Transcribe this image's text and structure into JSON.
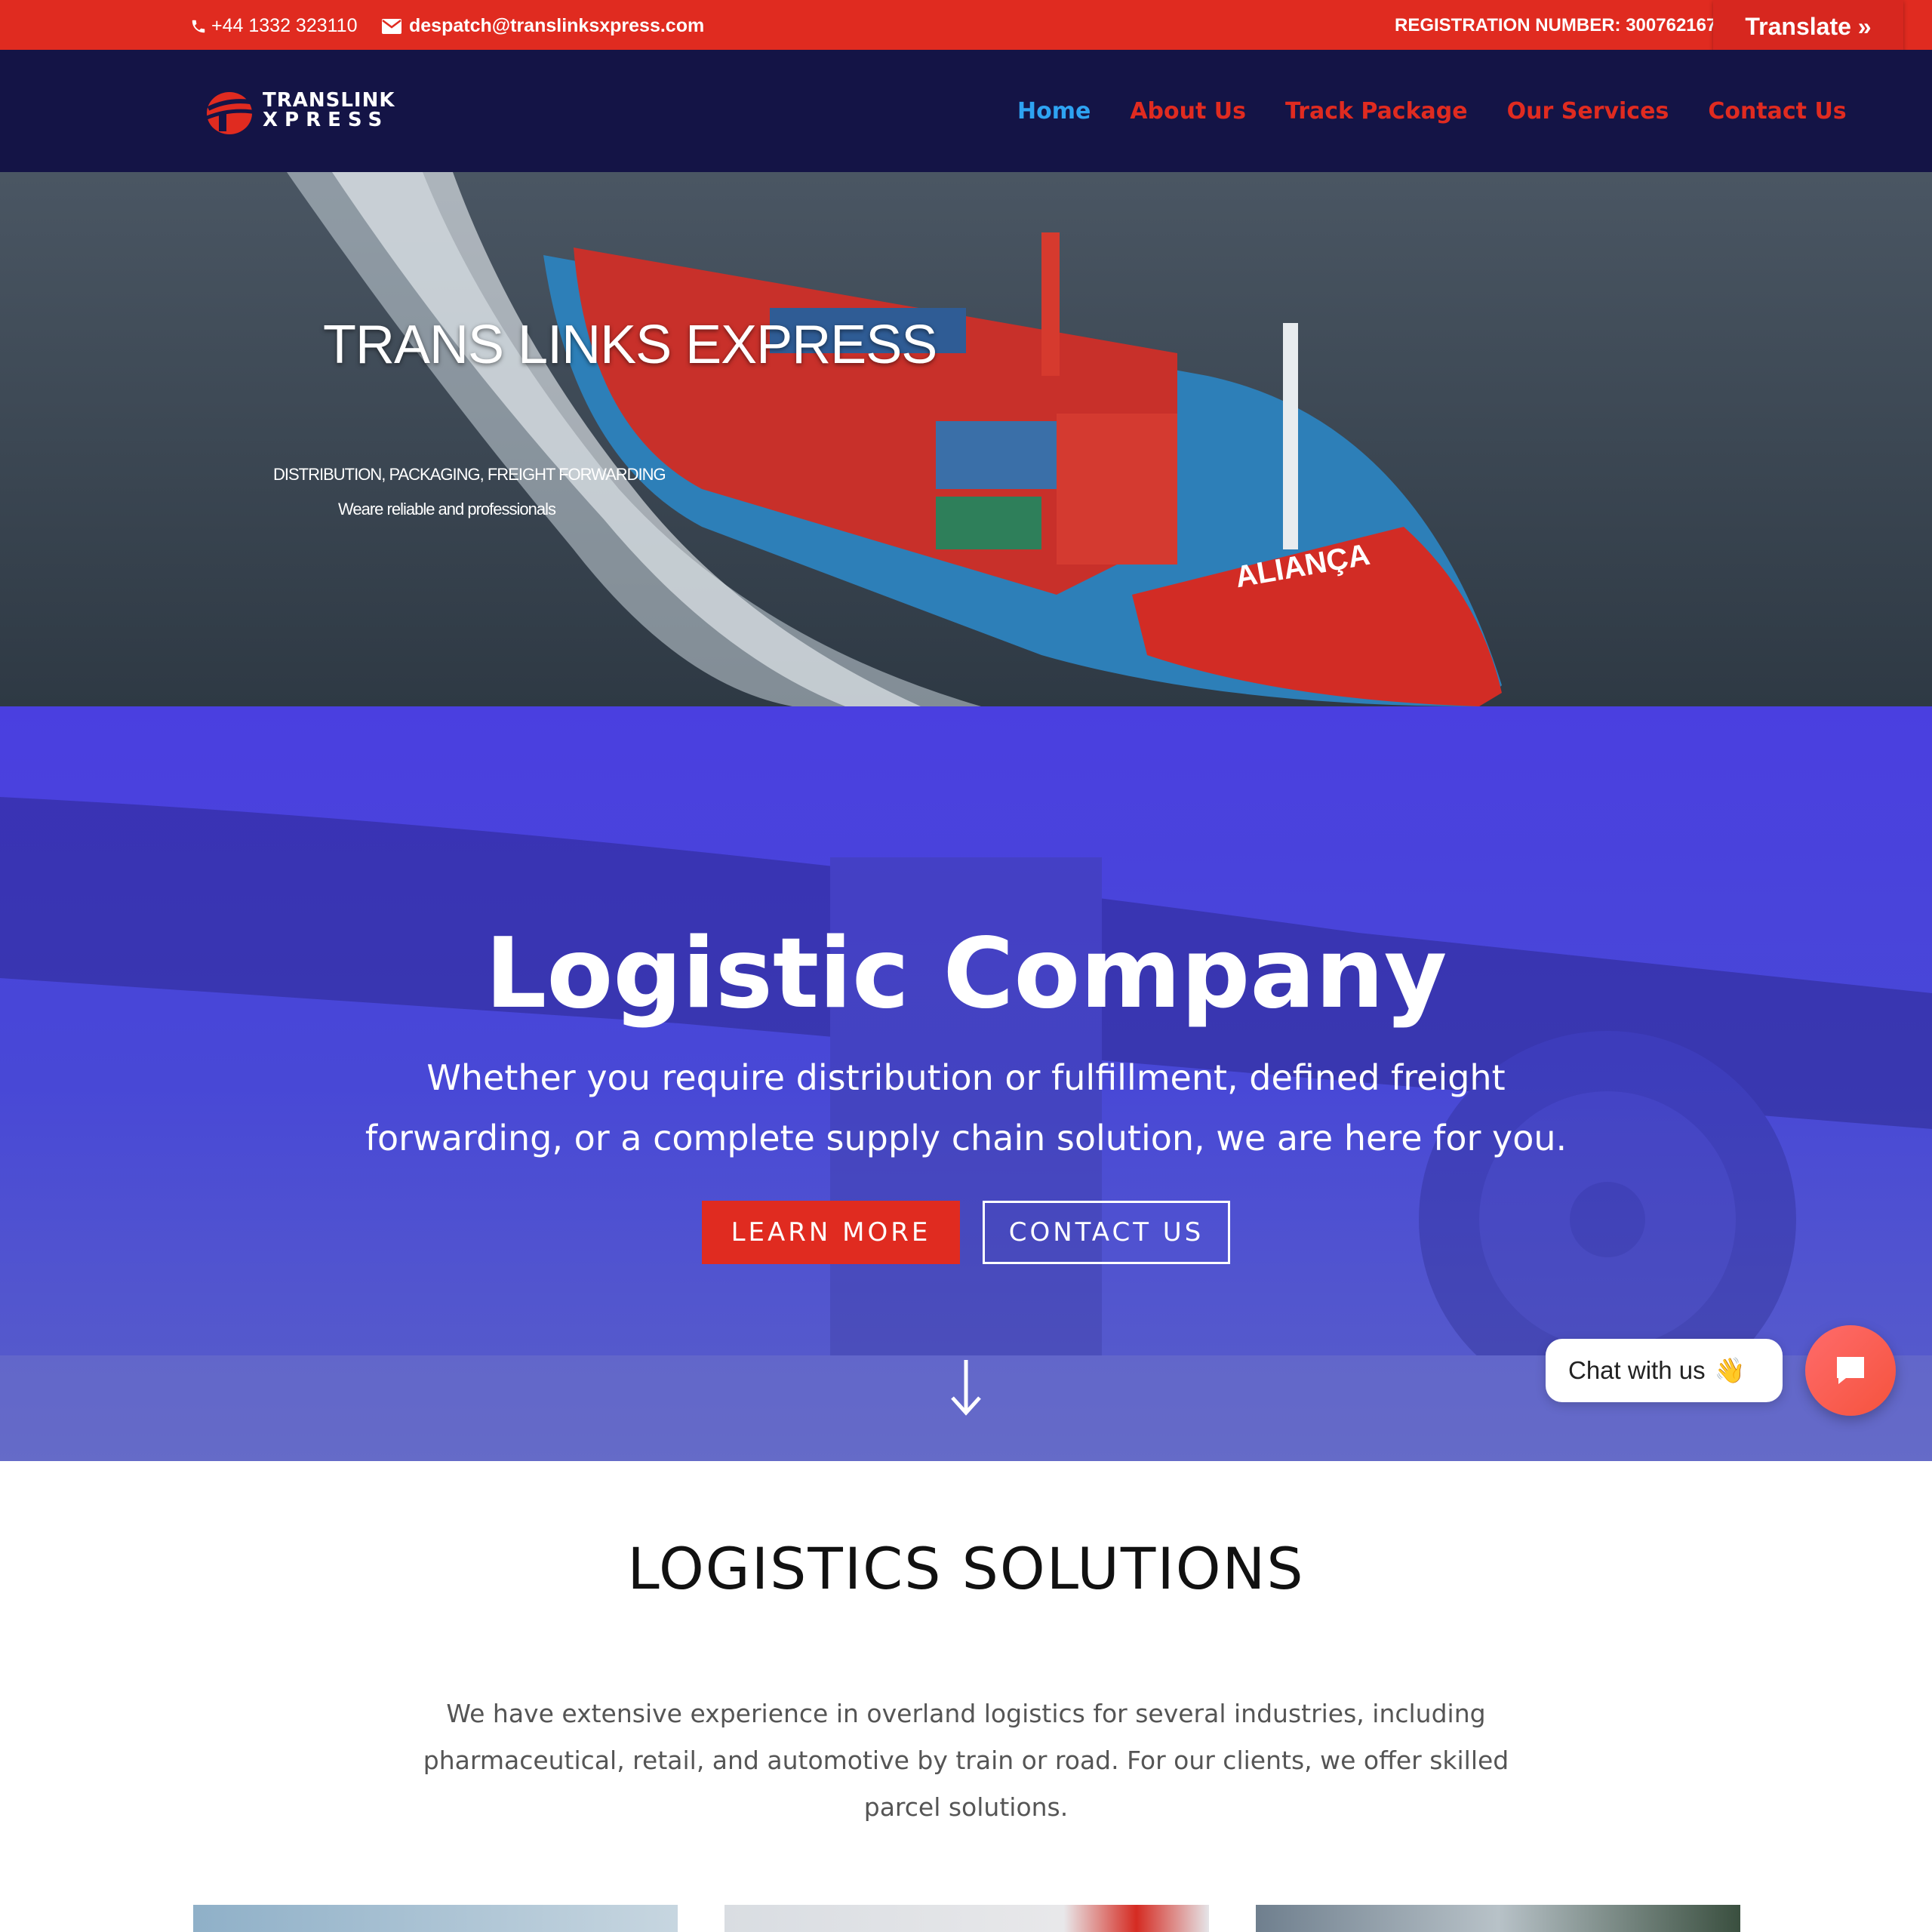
{
  "topbar": {
    "phone": "+44 1332 323110",
    "email": "despatch@translinksxpress.com",
    "registration": "REGISTRATION NUMBER: 300762167",
    "translate_label": "Translate »"
  },
  "header": {
    "logo_line1": "TRANSLINK",
    "logo_line2": "XPRESS",
    "nav": [
      {
        "label": "Home",
        "active": true
      },
      {
        "label": "About Us",
        "active": false
      },
      {
        "label": "Track Package",
        "active": false
      },
      {
        "label": "Our Services",
        "active": false
      },
      {
        "label": "Contact Us",
        "active": false
      }
    ]
  },
  "hero": {
    "title": "TRANS LINKS EXPRESS",
    "subtitle": "DISTRIBUTION, PACKAGING, FREIGHT FORWARDING",
    "tagline": "Weare reliable and professionals",
    "ship_name": "ALIANÇA"
  },
  "intro": {
    "title": "Logistic Company",
    "text": "Whether you require distribution or fulfillment, defined freight forwarding, or a complete supply chain solution, we are here for you.",
    "learn_more": "LEARN MORE",
    "contact_us": "CONTACT US"
  },
  "chat": {
    "label": "Chat with us",
    "emoji": "👋"
  },
  "solutions": {
    "title": "LOGISTICS SOLUTIONS",
    "text": "We have extensive experience in overland logistics for several industries, including pharmaceutical, retail, and automotive by train or road. For our clients, we offer skilled parcel solutions."
  },
  "colors": {
    "topbar": "#e02b20",
    "header": "#141446",
    "nav_active": "#2ea3f2",
    "nav_link": "#e02b20",
    "blue_overlay": "#4a3fe0",
    "button_red": "#e02b20"
  }
}
